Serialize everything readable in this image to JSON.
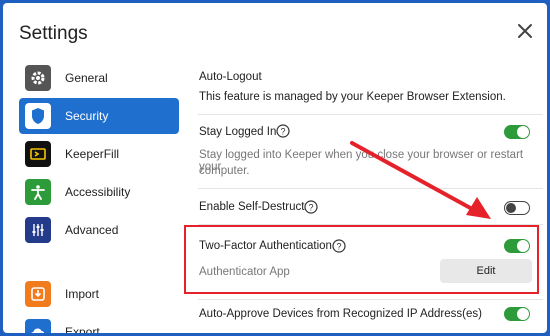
{
  "title": "Settings",
  "sidebar": {
    "items": [
      {
        "label": "General",
        "icon": "gear-icon",
        "color": "#555555"
      },
      {
        "label": "Security",
        "icon": "shield-icon",
        "color": "#1f6fcf"
      },
      {
        "label": "KeeperFill",
        "icon": "keeperfill-icon",
        "color": "#111111"
      },
      {
        "label": "Accessibility",
        "icon": "accessibility-icon",
        "color": "#2e9b3a"
      },
      {
        "label": "Advanced",
        "icon": "sliders-icon",
        "color": "#243a8a"
      },
      {
        "label": "Import",
        "icon": "import-icon",
        "color": "#f07c1e"
      },
      {
        "label": "Export",
        "icon": "cloud-export-icon",
        "color": "#1f6fcf"
      }
    ]
  },
  "main": {
    "auto_logout": {
      "title": "Auto-Logout",
      "desc": "This feature is managed by your Keeper Browser Extension."
    },
    "stay_logged_in": {
      "label": "Stay Logged In",
      "desc1": "Stay logged into Keeper when you close your browser or restart your",
      "desc2": "computer.",
      "enabled": true
    },
    "self_destruct": {
      "label": "Enable Self-Destruct",
      "enabled": false
    },
    "two_factor": {
      "label": "Two-Factor Authentication",
      "enabled": true,
      "method": "Authenticator App",
      "edit_label": "Edit"
    },
    "auto_approve": {
      "label": "Auto-Approve Devices from Recognized IP Address(es)",
      "enabled": true
    }
  },
  "colors": {
    "accent": "#1f6fcf",
    "toggle_on": "#2e9b3a",
    "toggle_off": "#bbbbbb",
    "annotation_red": "#e5222a",
    "frame": "#1f5fbf"
  }
}
